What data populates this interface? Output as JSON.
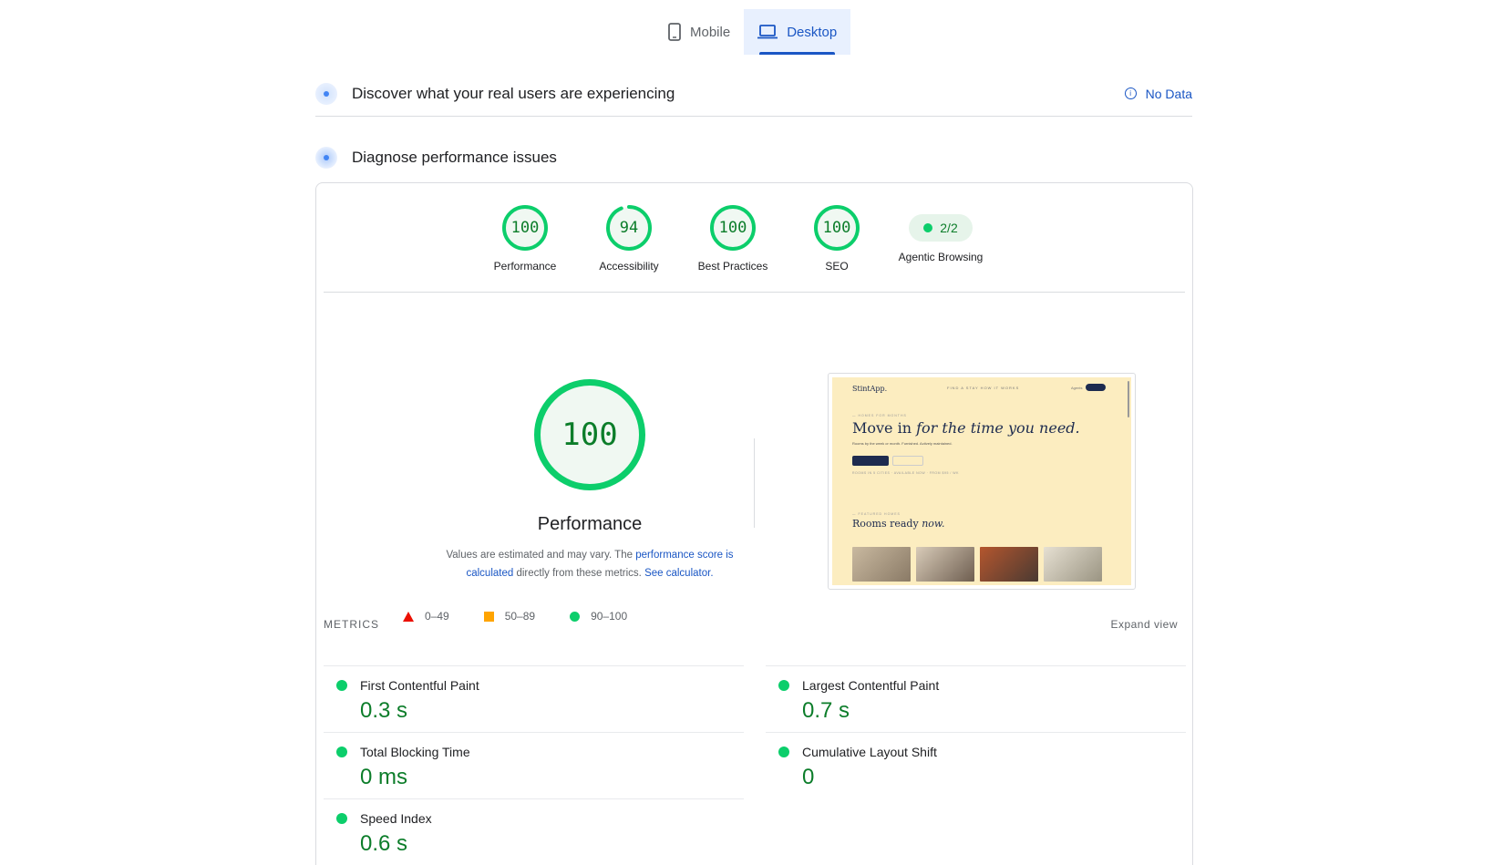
{
  "tabs": [
    {
      "label": "Mobile",
      "icon": "phone-icon",
      "active": false
    },
    {
      "label": "Desktop",
      "icon": "laptop-icon",
      "active": true
    }
  ],
  "field_section": {
    "title": "Discover what your real users are experiencing",
    "status": "No Data"
  },
  "lab_section": {
    "title": "Diagnose performance issues"
  },
  "categories": [
    {
      "label": "Performance",
      "score": "100",
      "fraction": 1.0
    },
    {
      "label": "Accessibility",
      "score": "94",
      "fraction": 0.94
    },
    {
      "label": "Best Practices",
      "score": "100",
      "fraction": 1.0
    },
    {
      "label": "SEO",
      "score": "100",
      "fraction": 1.0
    },
    {
      "label": "Agentic Browsing",
      "score": "2/2"
    }
  ],
  "performance": {
    "score": "100",
    "fraction": 1.0,
    "title": "Performance",
    "desc_pre": "Values are estimated and may vary. The ",
    "desc_link1": "performance score is calculated",
    "desc_mid": " directly from these metrics. ",
    "desc_link2": "See calculator."
  },
  "legend": [
    {
      "shape": "triangle",
      "color": "#eb0f00",
      "range": "0–49"
    },
    {
      "shape": "square",
      "color": "#ffa400",
      "range": "50–89"
    },
    {
      "shape": "circle",
      "color": "#0cce6b",
      "range": "90–100"
    }
  ],
  "screenshot": {
    "logo": "StintApp.",
    "nav": "FIND A STAY    HOW IT WORKS",
    "nav_right": "Agents",
    "kicker": "— HOMES FOR MONTHS",
    "headline_plain": "Move in ",
    "headline_italic": "for the time you need.",
    "sub": "Rooms by the week or month. Furnished. Actively maintained.",
    "meta": "ROOMS IN 5 CITIES · AVAILABLE NOW · FROM $95 / WK",
    "kicker2": "— FEATURED HOMES",
    "headline2_plain": "Rooms ready ",
    "headline2_italic": "now."
  },
  "metrics": {
    "heading": "METRICS",
    "expand": "Expand view",
    "left": [
      {
        "name": "First Contentful Paint",
        "value": "0.3 s"
      },
      {
        "name": "Total Blocking Time",
        "value": "0 ms"
      },
      {
        "name": "Speed Index",
        "value": "0.6 s"
      }
    ],
    "right": [
      {
        "name": "Largest Contentful Paint",
        "value": "0.7 s"
      },
      {
        "name": "Cumulative Layout Shift",
        "value": "0"
      }
    ]
  },
  "colors": {
    "pass": "#0cce6b",
    "pass_text": "#0c7d2a",
    "accent": "#1a56c4"
  }
}
